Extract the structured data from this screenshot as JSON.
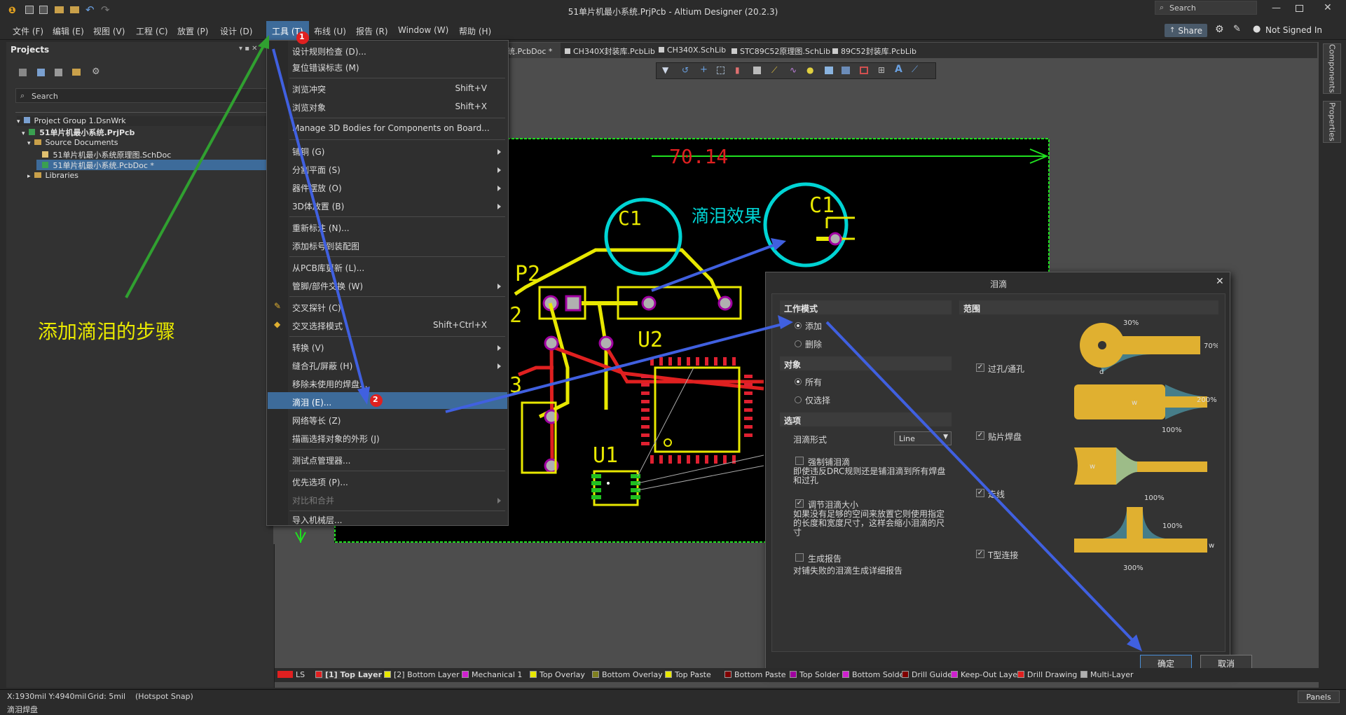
{
  "window": {
    "title": "51单片机最小系统.PrjPcb - Altium Designer (20.2.3)",
    "search_placeholder": "Search"
  },
  "top_right": {
    "share": "Share",
    "user": "Not Signed In"
  },
  "menu": [
    "文件 (F)",
    "编辑 (E)",
    "视图 (V)",
    "工程 (C)",
    "放置 (P)",
    "设计 (D)",
    "工具 (T)",
    "布线 (U)",
    "报告 (R)",
    "Window (W)",
    "帮助 (H)"
  ],
  "projects": {
    "title": "Projects",
    "search_placeholder": "Search",
    "tree": [
      "Project Group 1.DsnWrk",
      "51单片机最小系统.PrjPcb",
      "Source Documents",
      "51单片机最小系统原理图.SchDoc",
      "51单片机最小系统.PcbDoc *",
      "Libraries"
    ]
  },
  "doc_tabs": [
    "统.PcbDoc *",
    "CH340X封装库.PcbLib",
    "CH340X.SchLib",
    "STC89C52原理图.SchLib",
    "89C52封装库.PcbLib"
  ],
  "tools_menu": {
    "items": [
      {
        "label": "设计规则检查 (D)...",
        "shortcut": ""
      },
      {
        "label": "复位错误标志 (M)",
        "shortcut": ""
      },
      {
        "label": "浏览冲突",
        "shortcut": "Shift+V"
      },
      {
        "label": "浏览对象",
        "shortcut": "Shift+X"
      },
      {
        "label": "Manage 3D Bodies for Components on Board...",
        "shortcut": ""
      },
      {
        "label": "铺铜 (G)",
        "shortcut": ""
      },
      {
        "label": "分割平面 (S)",
        "shortcut": ""
      },
      {
        "label": "器件摆放 (O)",
        "shortcut": ""
      },
      {
        "label": "3D体放置 (B)",
        "shortcut": ""
      },
      {
        "label": "重新标注 (N)...",
        "shortcut": ""
      },
      {
        "label": "添加标号到装配图",
        "shortcut": ""
      },
      {
        "label": "从PCB库更新 (L)...",
        "shortcut": ""
      },
      {
        "label": "管脚/部件交换 (W)",
        "shortcut": ""
      },
      {
        "label": "交叉探针 (C)",
        "shortcut": ""
      },
      {
        "label": "交叉选择模式",
        "shortcut": "Shift+Ctrl+X"
      },
      {
        "label": "转换 (V)",
        "shortcut": ""
      },
      {
        "label": "缝合孔/屏蔽 (H)",
        "shortcut": ""
      },
      {
        "label": "移除未使用的焊盘...",
        "shortcut": ""
      },
      {
        "label": "滴泪 (E)...",
        "shortcut": ""
      },
      {
        "label": "网络等长 (Z)",
        "shortcut": ""
      },
      {
        "label": "描画选择对象的外形 (J)",
        "shortcut": ""
      },
      {
        "label": "测试点管理器...",
        "shortcut": ""
      },
      {
        "label": "优先选项 (P)...",
        "shortcut": ""
      },
      {
        "label": "对比和合并",
        "shortcut": ""
      },
      {
        "label": "导入机械层...",
        "shortcut": ""
      }
    ]
  },
  "pcb": {
    "dimension": "70.14",
    "labels": [
      "P2",
      "C1",
      "C1",
      "U2",
      "U1",
      "2",
      "3"
    ],
    "effect_text": "滴泪效果"
  },
  "annotation": {
    "steps_text": "添加滴泪的步骤",
    "badge1": "1",
    "badge2": "2"
  },
  "dialog": {
    "title": "泪滴",
    "mode": {
      "header": "工作模式",
      "add": "添加",
      "remove": "删除"
    },
    "objects": {
      "header": "对象",
      "all": "所有",
      "selected": "仅选择"
    },
    "options": {
      "header": "选项",
      "shape_label": "泪滴形式",
      "shape_value": "Line",
      "force_label": "强制铺泪滴",
      "force_desc": "即使违反DRC规则还是铺泪滴到所有焊盘和过孔",
      "adjust_label": "调节泪滴大小",
      "adjust_desc": "如果没有足够的空间来放置它则使用指定的长度和宽度尺寸，这样会缩小泪滴的尺寸",
      "report_label": "生成报告",
      "report_desc": "对铺失败的泪滴生成详细报告"
    },
    "scope": {
      "header": "范围",
      "via": "过孔/通孔",
      "smd": "贴片焊盘",
      "track": "走线",
      "t": "T型连接",
      "p30": "30%",
      "p70": "70%",
      "d": "d",
      "w": "w",
      "p200": "200%",
      "p100a": "100%",
      "p100b": "100%",
      "p100c": "100%",
      "p300": "300%"
    },
    "ok": "确定",
    "cancel": "取消"
  },
  "layers": [
    "LS",
    "[1] Top Layer",
    "[2] Bottom Layer",
    "Mechanical 1",
    "Top Overlay",
    "Bottom Overlay",
    "Top Paste",
    "Bottom Paste",
    "Top Solder",
    "Bottom Solder",
    "Drill Guide",
    "Keep-Out Layer",
    "Drill Drawing",
    "Multi-Layer"
  ],
  "status": {
    "coords": "X:1930mil Y:4940mil",
    "grid": "Grid: 5mil",
    "snap": "(Hotspot Snap)",
    "message": "滴泪焊盘",
    "panels": "Panels"
  },
  "right_tabs": [
    "Components",
    "Properties"
  ],
  "colors": {
    "accent": "#4a90d9",
    "highlight": "#3d6b9a",
    "pcb_bg": "#000000",
    "track_yellow": "#e8e800",
    "pad_red": "#e0202a",
    "cyan": "#00d4d4",
    "teardrop_fill": "#e0b030"
  }
}
